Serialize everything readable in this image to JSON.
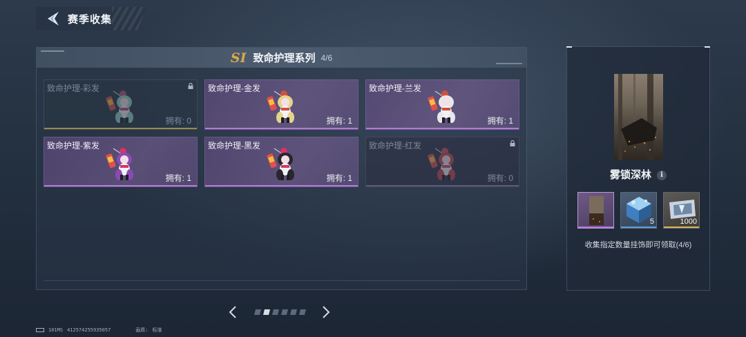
{
  "header": {
    "title": "赛季收集"
  },
  "series": {
    "badge": "SI",
    "title": "致命护理系列",
    "count": "4/6"
  },
  "cards": [
    {
      "name": "致命护理-彩发",
      "owned": "拥有: 0",
      "locked": true,
      "hair": "#9ad3c7",
      "accent": "#c04c7a"
    },
    {
      "name": "致命护理-金发",
      "owned": "拥有: 1",
      "locked": false,
      "hair": "#e6d38a",
      "accent": "#d0513a"
    },
    {
      "name": "致命护理-兰发",
      "owned": "拥有: 1",
      "locked": false,
      "hair": "#e8e8ec",
      "accent": "#d0513a"
    },
    {
      "name": "致命护理-紫发",
      "owned": "拥有: 1",
      "locked": false,
      "hair": "#8a4ab3",
      "accent": "#d8336b"
    },
    {
      "name": "致命护理-黑发",
      "owned": "拥有: 1",
      "locked": false,
      "hair": "#2a2630",
      "accent": "#d8336b"
    },
    {
      "name": "致命护理-红发",
      "owned": "拥有: 0",
      "locked": true,
      "hair": "#c44a4a",
      "accent": "#d84a66"
    }
  ],
  "pager": {
    "pages": 6,
    "active": 1
  },
  "reward": {
    "name": "雾锁深林",
    "info_icon": "i",
    "items": [
      {
        "kind": "portrait",
        "count": ""
      },
      {
        "kind": "crystal",
        "count": "5"
      },
      {
        "kind": "ticket",
        "count": "1000"
      }
    ],
    "hint": "收集指定数量挂饰即可领取(4/6)"
  },
  "footer": {
    "ping": "101MS",
    "uid": "412574255935057",
    "quality_label": "画质:",
    "quality": "标准"
  }
}
